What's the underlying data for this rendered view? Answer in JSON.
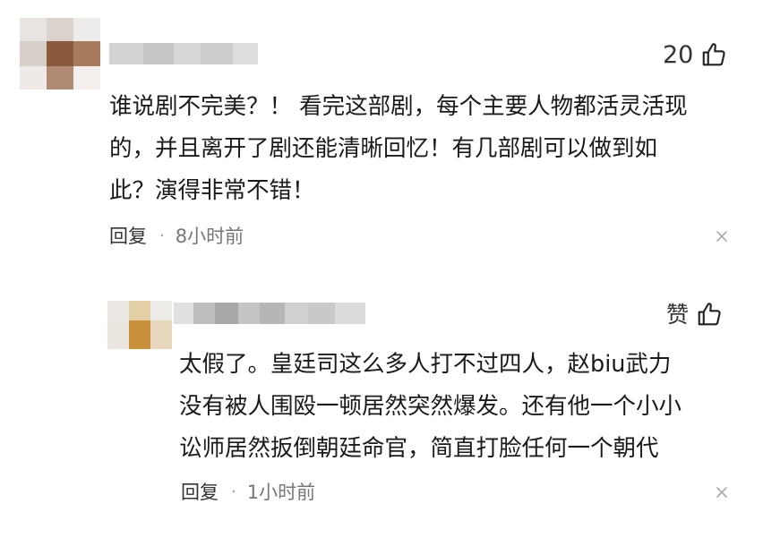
{
  "comments": [
    {
      "like_count": "20",
      "thumb_icon": "thumbs-up-icon",
      "body_lines": [
        "谁说剧不完美？！ 看完这部剧，每个主要人物都活灵活现",
        "的，并且离开了剧还能清晰回忆！有几部剧可以做到如",
        "此？演得非常不错！"
      ],
      "reply_label": "回复",
      "separator": "·",
      "time": "8小时前",
      "close_icon": "close-icon"
    },
    {
      "like_label": "赞",
      "thumb_icon": "thumbs-up-icon",
      "body_lines": [
        "太假了。皇廷司这么多人打不过四人，赵biu武力",
        "没有被人围殴一顿居然突然爆发。还有他一个小小",
        "讼师居然扳倒朝廷命官，简直打脸任何一个朝代"
      ],
      "reply_label": "回复",
      "separator": "·",
      "time": "1小时前",
      "close_icon": "close-icon"
    }
  ],
  "colors": {
    "text": "#1a1a1a",
    "meta_gray": "#777777",
    "blur_gray": "#cfcfcf",
    "avatar_brown": "#8a5a3c",
    "avatar_orange": "#c8903a"
  }
}
